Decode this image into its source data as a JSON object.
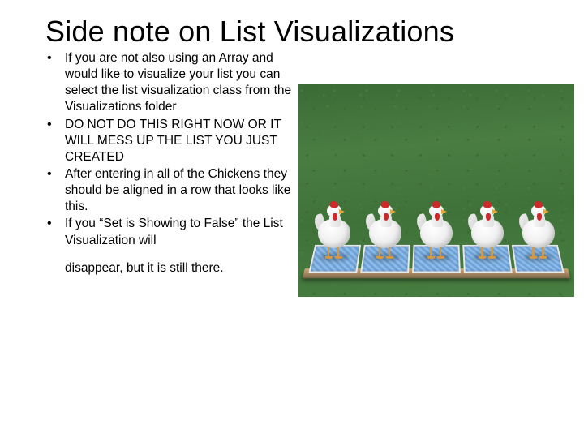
{
  "title": "Side note on List Visualizations",
  "bullets": {
    "b1": "If you are not also using an Array and would like to visualize your list you can select the list visualization class from the Visualizations folder",
    "b2": "DO NOT DO THIS RIGHT NOW OR IT WILL MESS UP THE LIST YOU JUST CREATED",
    "b3": "After entering in all of the Chickens they should be aligned in a row that looks like this.",
    "b4": "If you “Set is Showing to False” the List Visualization will"
  },
  "trailing": "disappear, but it is still there.",
  "image": {
    "alt": "Five chickens standing on a tiled platform on grass",
    "chicken_count": 5
  }
}
